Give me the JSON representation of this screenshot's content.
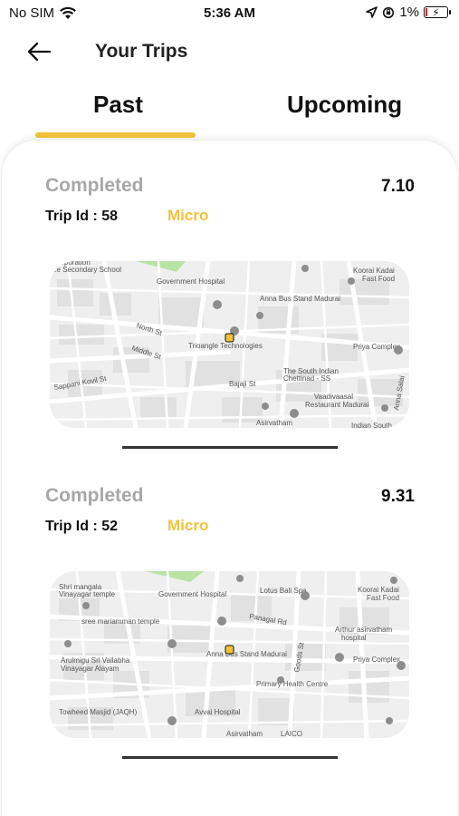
{
  "status_bar": {
    "carrier": "No SIM",
    "time": "5:36 AM",
    "battery": "1%",
    "icons": [
      "wifi-icon",
      "location-arrow-icon",
      "orientation-lock-icon",
      "battery-charging-icon"
    ]
  },
  "header": {
    "title": "Your Trips",
    "back_icon": "arrow-left-icon"
  },
  "tabs": [
    {
      "label": "Past",
      "active": true
    },
    {
      "label": "Upcoming",
      "active": false
    }
  ],
  "colors": {
    "accent": "#f2c33b",
    "muted": "#a7a7a7",
    "map_bg": "#efefef"
  },
  "trips": [
    {
      "status": "Completed",
      "amount": "7.10",
      "trip_id": "Trip Id : 58",
      "vehicle": "Micro",
      "map_labels": [
        "Corporation",
        "ee Secondary School",
        "Government Hospital",
        "Anna Bus Stand Madurai",
        "Koorai Kadai",
        "Fast Food",
        "North St",
        "Middle St",
        "Trioangle Technologies",
        "Priya Complex",
        "The South Indian",
        "Chettinad - SS",
        "Vaadivaasal",
        "Restaurant Madurai",
        "Sappani Kovil St",
        "Bajaji St",
        "Asirvatham",
        "Indian South",
        "Anna Salai"
      ]
    },
    {
      "status": "Completed",
      "amount": "9.31",
      "trip_id": "Trip Id : 52",
      "vehicle": "Micro",
      "map_labels": [
        "Shri mangala",
        "Vinayagar temple",
        "Government Hospital",
        "Lotus Bali Spa",
        "Koorai Kadai",
        "Fast Food",
        "sree mariamman temple",
        "Panagal Rd",
        "Arthur asirvatham",
        "hospital",
        "Arulmigu Sri Vallabha",
        "Vinayagar Alayam",
        "Anna Bus Stand Madurai",
        "Priya Complex",
        "Primary Health Centre",
        "Towheed Masjid (JAQH)",
        "Avvai Hospital",
        "Asirvatham",
        "LAICO",
        "Goods St"
      ]
    }
  ]
}
